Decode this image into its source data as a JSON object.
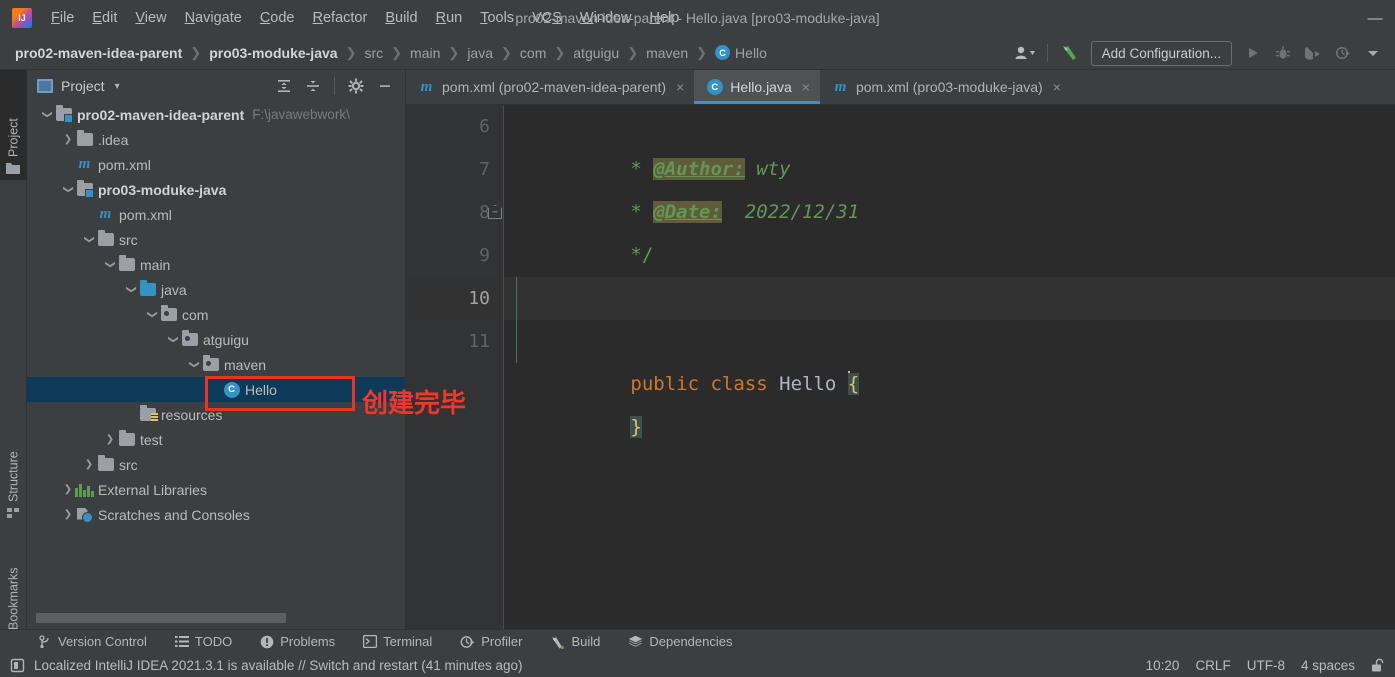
{
  "window": {
    "title": "pro02-maven-idea-parent - Hello.java [pro03-moduke-java]",
    "minimize_label": "—"
  },
  "menu": {
    "items": [
      {
        "label": "File",
        "mnemonic": "F"
      },
      {
        "label": "Edit",
        "mnemonic": "E"
      },
      {
        "label": "View",
        "mnemonic": "V"
      },
      {
        "label": "Navigate",
        "mnemonic": "N"
      },
      {
        "label": "Code",
        "mnemonic": "C"
      },
      {
        "label": "Refactor",
        "mnemonic": "R"
      },
      {
        "label": "Build",
        "mnemonic": "B"
      },
      {
        "label": "Run",
        "mnemonic": "R"
      },
      {
        "label": "Tools",
        "mnemonic": "T"
      },
      {
        "label": "VCS",
        "mnemonic": "S"
      },
      {
        "label": "Window",
        "mnemonic": "W"
      },
      {
        "label": "Help",
        "mnemonic": "H"
      }
    ]
  },
  "navbar": {
    "crumbs": [
      {
        "label": "pro02-maven-idea-parent",
        "bold": true,
        "icon": ""
      },
      {
        "label": "pro03-moduke-java",
        "bold": true,
        "icon": ""
      },
      {
        "label": "src",
        "bold": false,
        "icon": ""
      },
      {
        "label": "main",
        "bold": false,
        "icon": ""
      },
      {
        "label": "java",
        "bold": false,
        "icon": ""
      },
      {
        "label": "com",
        "bold": false,
        "icon": ""
      },
      {
        "label": "atguigu",
        "bold": false,
        "icon": ""
      },
      {
        "label": "maven",
        "bold": false,
        "icon": ""
      },
      {
        "label": "Hello",
        "bold": false,
        "icon": "class-badge",
        "badge": "C"
      }
    ],
    "separator": "❯",
    "add_configuration_label": "Add Configuration...",
    "icons": [
      "user-avatar-icon",
      "dropdown-arrow-icon",
      "build-hammer-icon",
      "run-icon",
      "debug-icon",
      "run-with-coverage-icon",
      "profile-icon",
      "more-dropdown-icon"
    ]
  },
  "left_strip": {
    "tabs": [
      {
        "label": "Project",
        "icon": "folder-icon",
        "active": true
      },
      {
        "label": "Structure",
        "icon": "structure-icon",
        "active": false
      },
      {
        "label": "Bookmarks",
        "icon": "bookmark-icon",
        "active": false
      }
    ]
  },
  "project_panel": {
    "title": "Project",
    "dropdown": "▾",
    "tools": [
      "expand-all-icon",
      "collapse-all-icon",
      "settings-gear-icon",
      "hide-icon"
    ],
    "tree": [
      {
        "indent": 0,
        "twist": "v",
        "icon": "module-folder-icon",
        "label": "pro02-maven-idea-parent",
        "bold": true,
        "path": "F:\\javawebwork\\",
        "selected": false
      },
      {
        "indent": 1,
        "twist": ">",
        "icon": "folder-icon",
        "label": ".idea",
        "bold": false,
        "selected": false
      },
      {
        "indent": 1,
        "twist": "",
        "icon": "maven-icon",
        "label": "pom.xml",
        "bold": false,
        "selected": false
      },
      {
        "indent": 1,
        "twist": "v",
        "icon": "module-folder-icon",
        "label": "pro03-moduke-java",
        "bold": true,
        "selected": false
      },
      {
        "indent": 2,
        "twist": "",
        "icon": "maven-icon",
        "label": "pom.xml",
        "bold": false,
        "selected": false
      },
      {
        "indent": 2,
        "twist": "v",
        "icon": "folder-icon",
        "label": "src",
        "bold": false,
        "selected": false
      },
      {
        "indent": 3,
        "twist": "v",
        "icon": "folder-icon",
        "label": "main",
        "bold": false,
        "selected": false
      },
      {
        "indent": 4,
        "twist": "v",
        "icon": "source-folder-icon",
        "label": "java",
        "bold": false,
        "selected": false
      },
      {
        "indent": 5,
        "twist": "v",
        "icon": "package-icon",
        "label": "com",
        "bold": false,
        "selected": false
      },
      {
        "indent": 6,
        "twist": "v",
        "icon": "package-icon",
        "label": "atguigu",
        "bold": false,
        "selected": false
      },
      {
        "indent": 7,
        "twist": "v",
        "icon": "package-icon",
        "label": "maven",
        "bold": false,
        "selected": false
      },
      {
        "indent": 8,
        "twist": "",
        "icon": "java-class-icon",
        "label": "Hello",
        "bold": false,
        "selected": true
      },
      {
        "indent": 4,
        "twist": "",
        "icon": "resources-folder-icon",
        "label": "resources",
        "bold": false,
        "selected": false
      },
      {
        "indent": 3,
        "twist": ">",
        "icon": "folder-icon",
        "label": "test",
        "bold": false,
        "selected": false
      },
      {
        "indent": 2,
        "twist": ">",
        "icon": "folder-icon",
        "label": "src",
        "bold": false,
        "selected": false
      },
      {
        "indent": 1,
        "twist": ">",
        "icon": "external-libraries-icon",
        "label": "External Libraries",
        "bold": false,
        "selected": false
      },
      {
        "indent": 1,
        "twist": ">",
        "icon": "scratches-icon",
        "label": "Scratches and Consoles",
        "bold": false,
        "selected": false
      }
    ]
  },
  "annotation": {
    "text": "创建完毕",
    "box_color": "#ee3124",
    "text_color": "#f5342a"
  },
  "editor": {
    "tabs": [
      {
        "label": "pom.xml (pro02-maven-idea-parent)",
        "icon": "maven-icon",
        "active": false,
        "close": "×"
      },
      {
        "label": "Hello.java",
        "icon": "java-class-icon",
        "active": true,
        "close": "×"
      },
      {
        "label": "pom.xml (pro03-moduke-java)",
        "icon": "maven-icon",
        "active": false,
        "close": "×"
      }
    ],
    "lines": [
      {
        "number": "6",
        "current": false,
        "fold": false
      },
      {
        "number": "7",
        "current": false,
        "fold": false
      },
      {
        "number": "8",
        "current": false,
        "fold": true
      },
      {
        "number": "9",
        "current": false,
        "fold": false
      },
      {
        "number": "10",
        "current": true,
        "fold": false
      },
      {
        "number": "11",
        "current": false,
        "fold": false
      }
    ],
    "code": {
      "l6_star": "* ",
      "l6_tag": "@Author:",
      "l6_value": " wty",
      "l7_star": "* ",
      "l7_tag": "@Date:",
      "l7_value": "  2022/12/31",
      "l8": "*/",
      "l10_kw1": "public",
      "l10_kw2": "class",
      "l10_name": "Hello",
      "l10_brace": "{",
      "l11_brace": "}"
    }
  },
  "bottom_bar": {
    "items": [
      {
        "label": "Version Control",
        "icon": "branch-icon"
      },
      {
        "label": "TODO",
        "icon": "list-icon"
      },
      {
        "label": "Problems",
        "icon": "warning-icon"
      },
      {
        "label": "Terminal",
        "icon": "terminal-icon"
      },
      {
        "label": "Profiler",
        "icon": "profiler-icon"
      },
      {
        "label": "Build",
        "icon": "hammer-icon"
      },
      {
        "label": "Dependencies",
        "icon": "layers-icon"
      }
    ]
  },
  "status_bar": {
    "message": "Localized IntelliJ IDEA 2021.3.1 is available // Switch and restart (41 minutes ago)",
    "message_icon": "notification-icon",
    "caret_position": "10:20",
    "line_separator": "CRLF",
    "encoding": "UTF-8",
    "indent": "4 spaces",
    "lock_icon": "unlocked-padlock-icon"
  }
}
